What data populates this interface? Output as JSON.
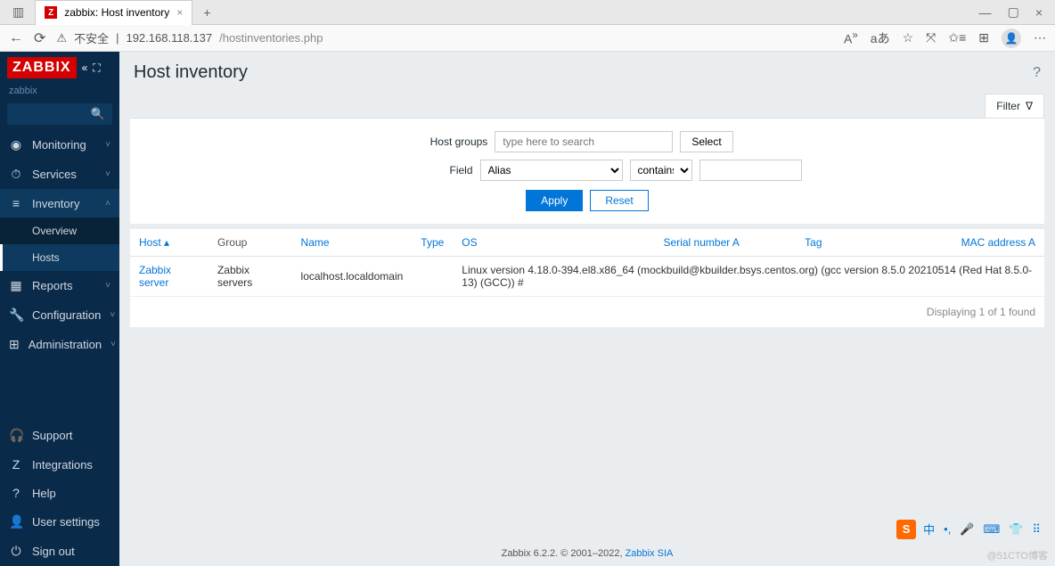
{
  "browser": {
    "tab_title": "zabbix: Host inventory",
    "url_warn": "不安全",
    "url_host": "192.168.118.137",
    "url_path": "/hostinventories.php"
  },
  "sidebar": {
    "logo": "ZABBIX",
    "crumb": "zabbix",
    "items": [
      {
        "icon": "◉",
        "label": "Monitoring",
        "chev": "˅"
      },
      {
        "icon": "⏱",
        "label": "Services",
        "chev": "˅"
      },
      {
        "icon": "≡",
        "label": "Inventory",
        "chev": "˄",
        "active": true
      },
      {
        "icon": "▦",
        "label": "Reports",
        "chev": "˅"
      },
      {
        "icon": "🔧",
        "label": "Configuration",
        "chev": "˅"
      },
      {
        "icon": "⊞",
        "label": "Administration",
        "chev": "˅"
      }
    ],
    "sub_items": [
      {
        "label": "Overview"
      },
      {
        "label": "Hosts",
        "active": true
      }
    ],
    "bottom": [
      {
        "icon": "🎧",
        "label": "Support"
      },
      {
        "icon": "Z",
        "label": "Integrations"
      },
      {
        "icon": "?",
        "label": "Help"
      },
      {
        "icon": "👤",
        "label": "User settings"
      },
      {
        "icon": "⏻",
        "label": "Sign out"
      }
    ]
  },
  "page": {
    "title": "Host inventory",
    "filter_label": "Filter",
    "form": {
      "host_groups_label": "Host groups",
      "host_groups_placeholder": "type here to search",
      "select_btn": "Select",
      "field_label": "Field",
      "field_value": "Alias",
      "operator": "contains",
      "apply": "Apply",
      "reset": "Reset"
    },
    "table": {
      "columns": [
        "Host ▴",
        "Group",
        "Name",
        "Type",
        "OS",
        "Serial number A",
        "Tag",
        "MAC address A"
      ],
      "rows": [
        {
          "host": "Zabbix server",
          "group": "Zabbix servers",
          "name": "localhost.localdomain",
          "type": "",
          "os": "Linux version 4.18.0-394.el8.x86_64 (mockbuild@kbuilder.bsys.centos.org) (gcc version 8.5.0 20210514 (Red Hat 8.5.0-13) (GCC)) #",
          "serial": "",
          "tag": "",
          "mac": ""
        }
      ],
      "count": "Displaying 1 of 1 found"
    },
    "footer_text": "Zabbix 6.2.2. © 2001–2022, ",
    "footer_link": "Zabbix SIA"
  },
  "watermark": "@51CTO博客",
  "ime": {
    "s": "S",
    "cn": "中"
  }
}
